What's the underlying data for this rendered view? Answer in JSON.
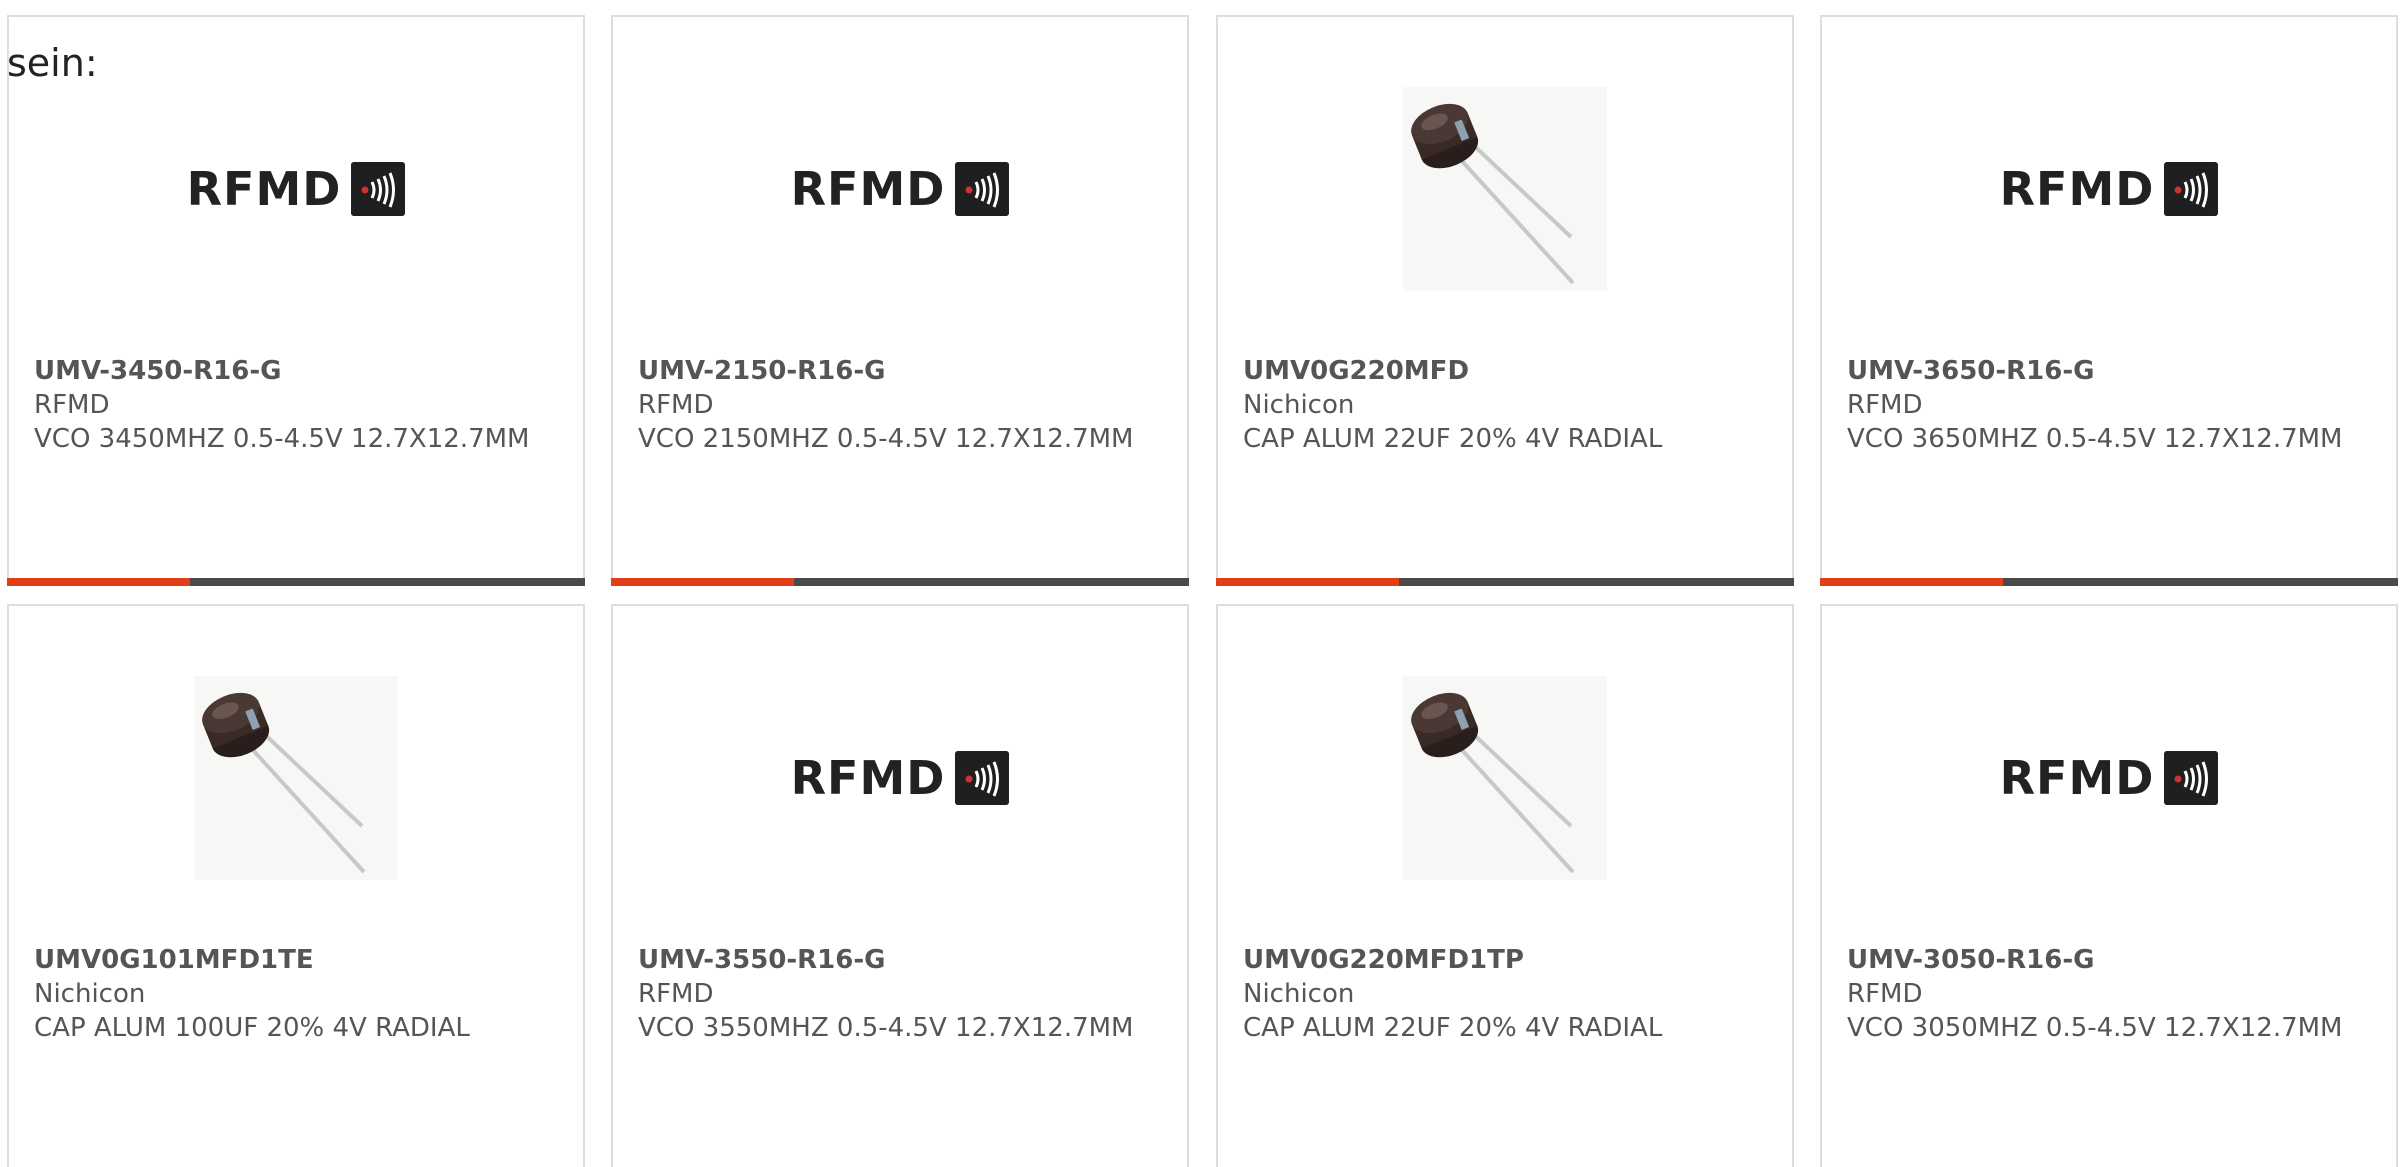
{
  "intro": {
    "text": "sein:"
  },
  "colors": {
    "accent": "#e04018",
    "bar": "#4a4a4a",
    "text": "#555555",
    "border": "#dddddd"
  },
  "products": [
    {
      "part_number": "UMV-3450-R16-G",
      "manufacturer": "RFMD",
      "description": "VCO 3450MHZ 0.5-4.5V 12.7X12.7MM",
      "image": "rfmd-logo",
      "image_text": "RFMD"
    },
    {
      "part_number": "UMV-2150-R16-G",
      "manufacturer": "RFMD",
      "description": "VCO 2150MHZ 0.5-4.5V 12.7X12.7MM",
      "image": "rfmd-logo",
      "image_text": "RFMD"
    },
    {
      "part_number": "UMV0G220MFD",
      "manufacturer": "Nichicon",
      "description": "CAP ALUM 22UF 20% 4V RADIAL",
      "image": "capacitor-photo"
    },
    {
      "part_number": "UMV-3650-R16-G",
      "manufacturer": "RFMD",
      "description": "VCO 3650MHZ 0.5-4.5V 12.7X12.7MM",
      "image": "rfmd-logo",
      "image_text": "RFMD"
    },
    {
      "part_number": "UMV0G101MFD1TE",
      "manufacturer": "Nichicon",
      "description": "CAP ALUM 100UF 20% 4V RADIAL",
      "image": "capacitor-photo"
    },
    {
      "part_number": "UMV-3550-R16-G",
      "manufacturer": "RFMD",
      "description": "VCO 3550MHZ 0.5-4.5V 12.7X12.7MM",
      "image": "rfmd-logo",
      "image_text": "RFMD"
    },
    {
      "part_number": "UMV0G220MFD1TP",
      "manufacturer": "Nichicon",
      "description": "CAP ALUM 22UF 20% 4V RADIAL",
      "image": "capacitor-photo"
    },
    {
      "part_number": "UMV-3050-R16-G",
      "manufacturer": "RFMD",
      "description": "VCO 3050MHZ 0.5-4.5V 12.7X12.7MM",
      "image": "rfmd-logo",
      "image_text": "RFMD"
    }
  ]
}
